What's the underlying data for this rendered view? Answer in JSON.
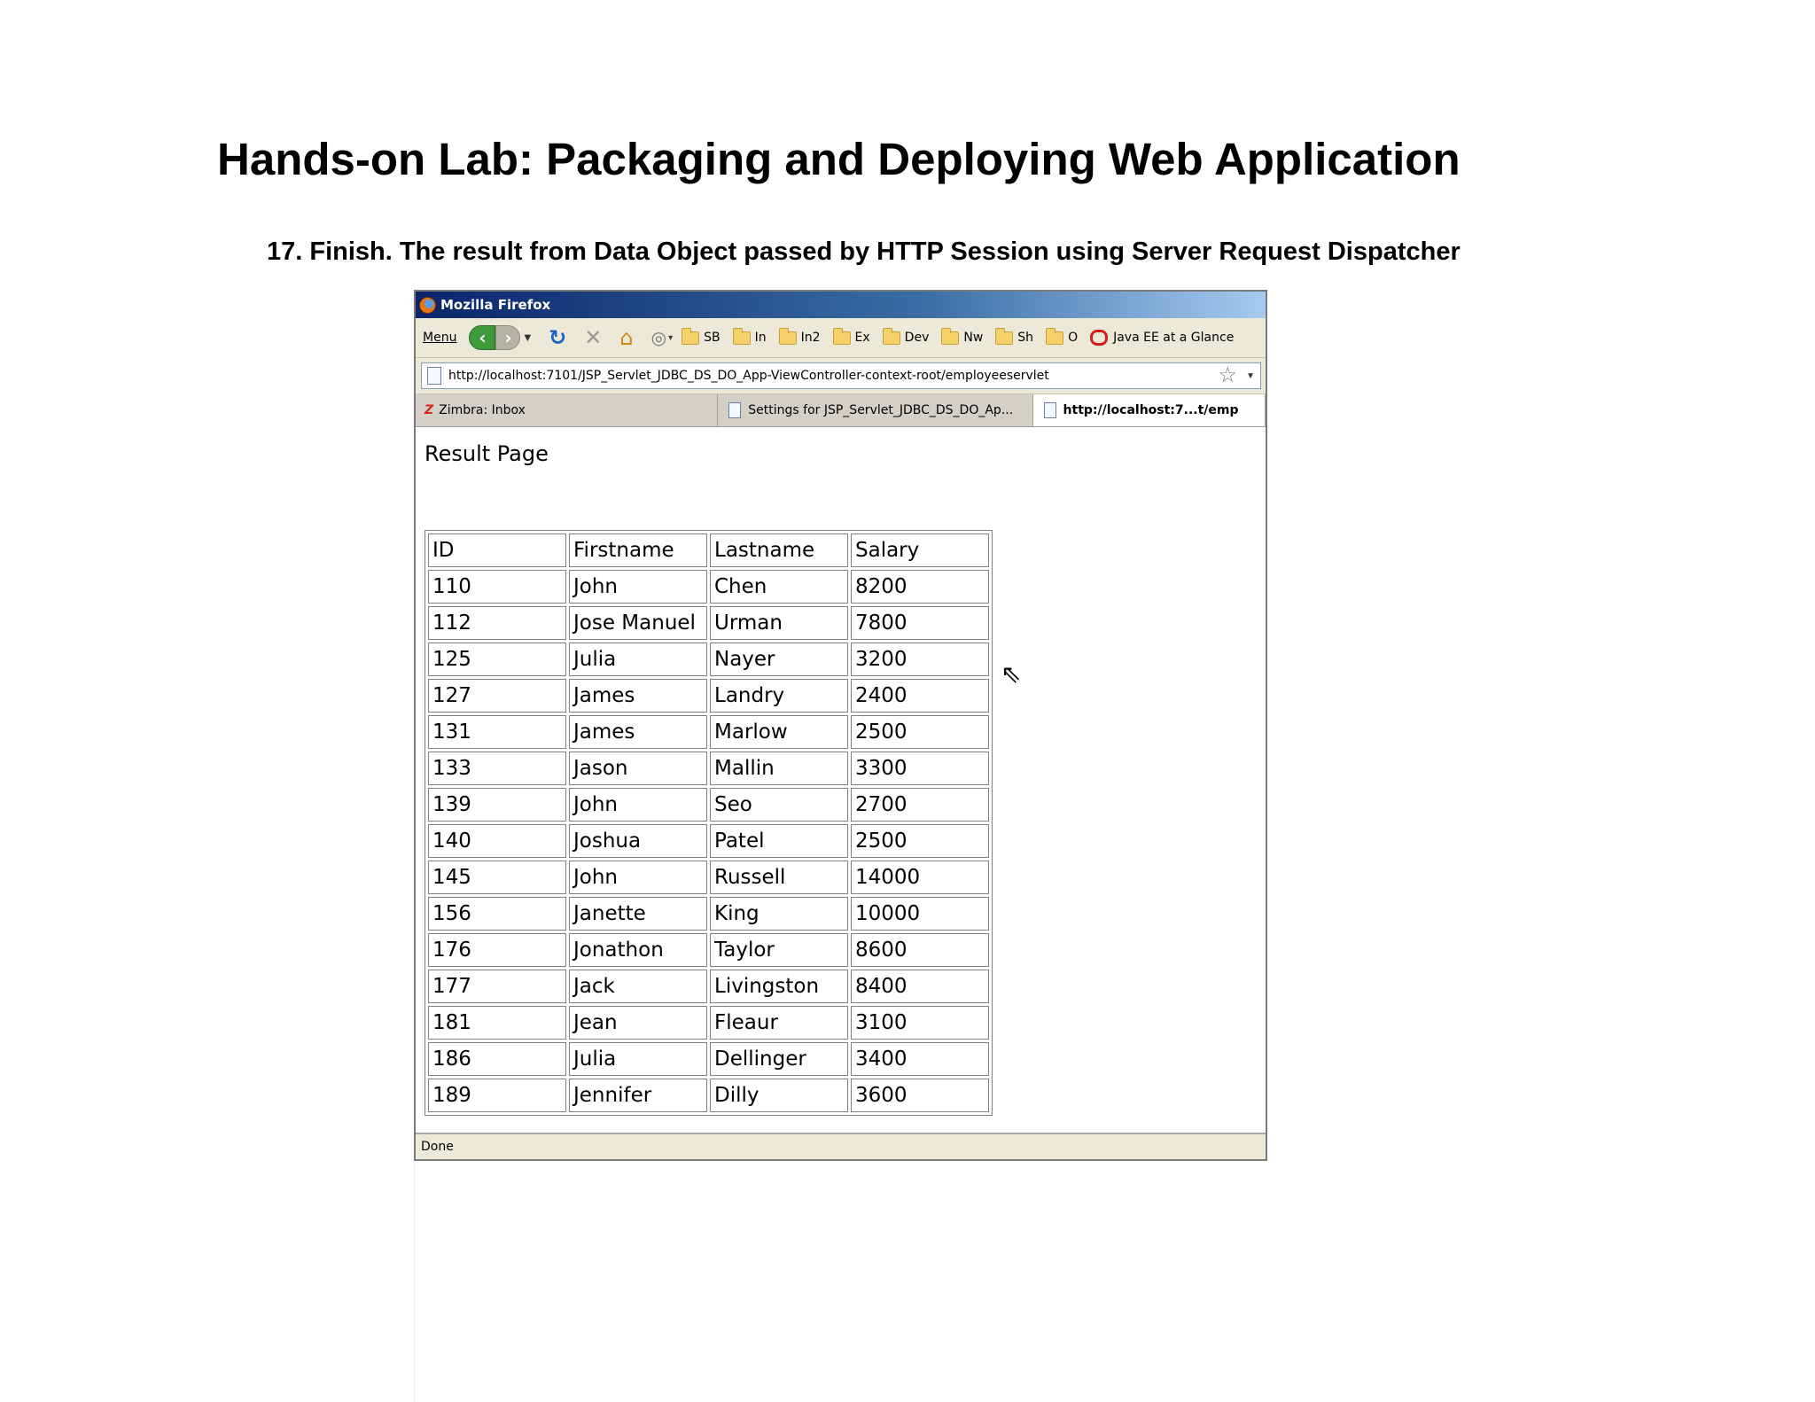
{
  "slide": {
    "title": "Hands-on Lab: Packaging and Deploying Web Application",
    "step": "17. Finish. The result from Data Object passed by HTTP Session using Server Request Dispatcher"
  },
  "browser": {
    "window_title": "Mozilla Firefox",
    "menu_label": "Menu",
    "bookmarks": [
      {
        "label": "SB",
        "icon": "folder-icon"
      },
      {
        "label": "In",
        "icon": "folder-icon"
      },
      {
        "label": "In2",
        "icon": "folder-icon"
      },
      {
        "label": "Ex",
        "icon": "folder-icon"
      },
      {
        "label": "Dev",
        "icon": "folder-icon"
      },
      {
        "label": "Nw",
        "icon": "folder-icon"
      },
      {
        "label": "Sh",
        "icon": "folder-icon"
      },
      {
        "label": "O",
        "icon": "folder-icon"
      },
      {
        "label": "Java EE at a Glance",
        "icon": "oracle-icon"
      }
    ],
    "url": "http://localhost:7101/JSP_Servlet_JDBC_DS_DO_App-ViewController-context-root/employeeservlet",
    "tabs": [
      {
        "label": "Zimbra: Inbox",
        "active": false
      },
      {
        "label": "Settings for JSP_Servlet_JDBC_DS_DO_Ap...",
        "active": false
      },
      {
        "label": "http://localhost:7...t/emp",
        "active": true
      }
    ],
    "status": "Done"
  },
  "page": {
    "heading": "Result Page",
    "table": {
      "headers": [
        "ID",
        "Firstname",
        "Lastname",
        "Salary"
      ],
      "rows": [
        [
          "110",
          "John",
          "Chen",
          "8200"
        ],
        [
          "112",
          "Jose Manuel",
          "Urman",
          "7800"
        ],
        [
          "125",
          "Julia",
          "Nayer",
          "3200"
        ],
        [
          "127",
          "James",
          "Landry",
          "2400"
        ],
        [
          "131",
          "James",
          "Marlow",
          "2500"
        ],
        [
          "133",
          "Jason",
          "Mallin",
          "3300"
        ],
        [
          "139",
          "John",
          "Seo",
          "2700"
        ],
        [
          "140",
          "Joshua",
          "Patel",
          "2500"
        ],
        [
          "145",
          "John",
          "Russell",
          "14000"
        ],
        [
          "156",
          "Janette",
          "King",
          "10000"
        ],
        [
          "176",
          "Jonathon",
          "Taylor",
          "8600"
        ],
        [
          "177",
          "Jack",
          "Livingston",
          "8400"
        ],
        [
          "181",
          "Jean",
          "Fleaur",
          "3100"
        ],
        [
          "186",
          "Julia",
          "Dellinger",
          "3400"
        ],
        [
          "189",
          "Jennifer",
          "Dilly",
          "3600"
        ]
      ]
    }
  }
}
